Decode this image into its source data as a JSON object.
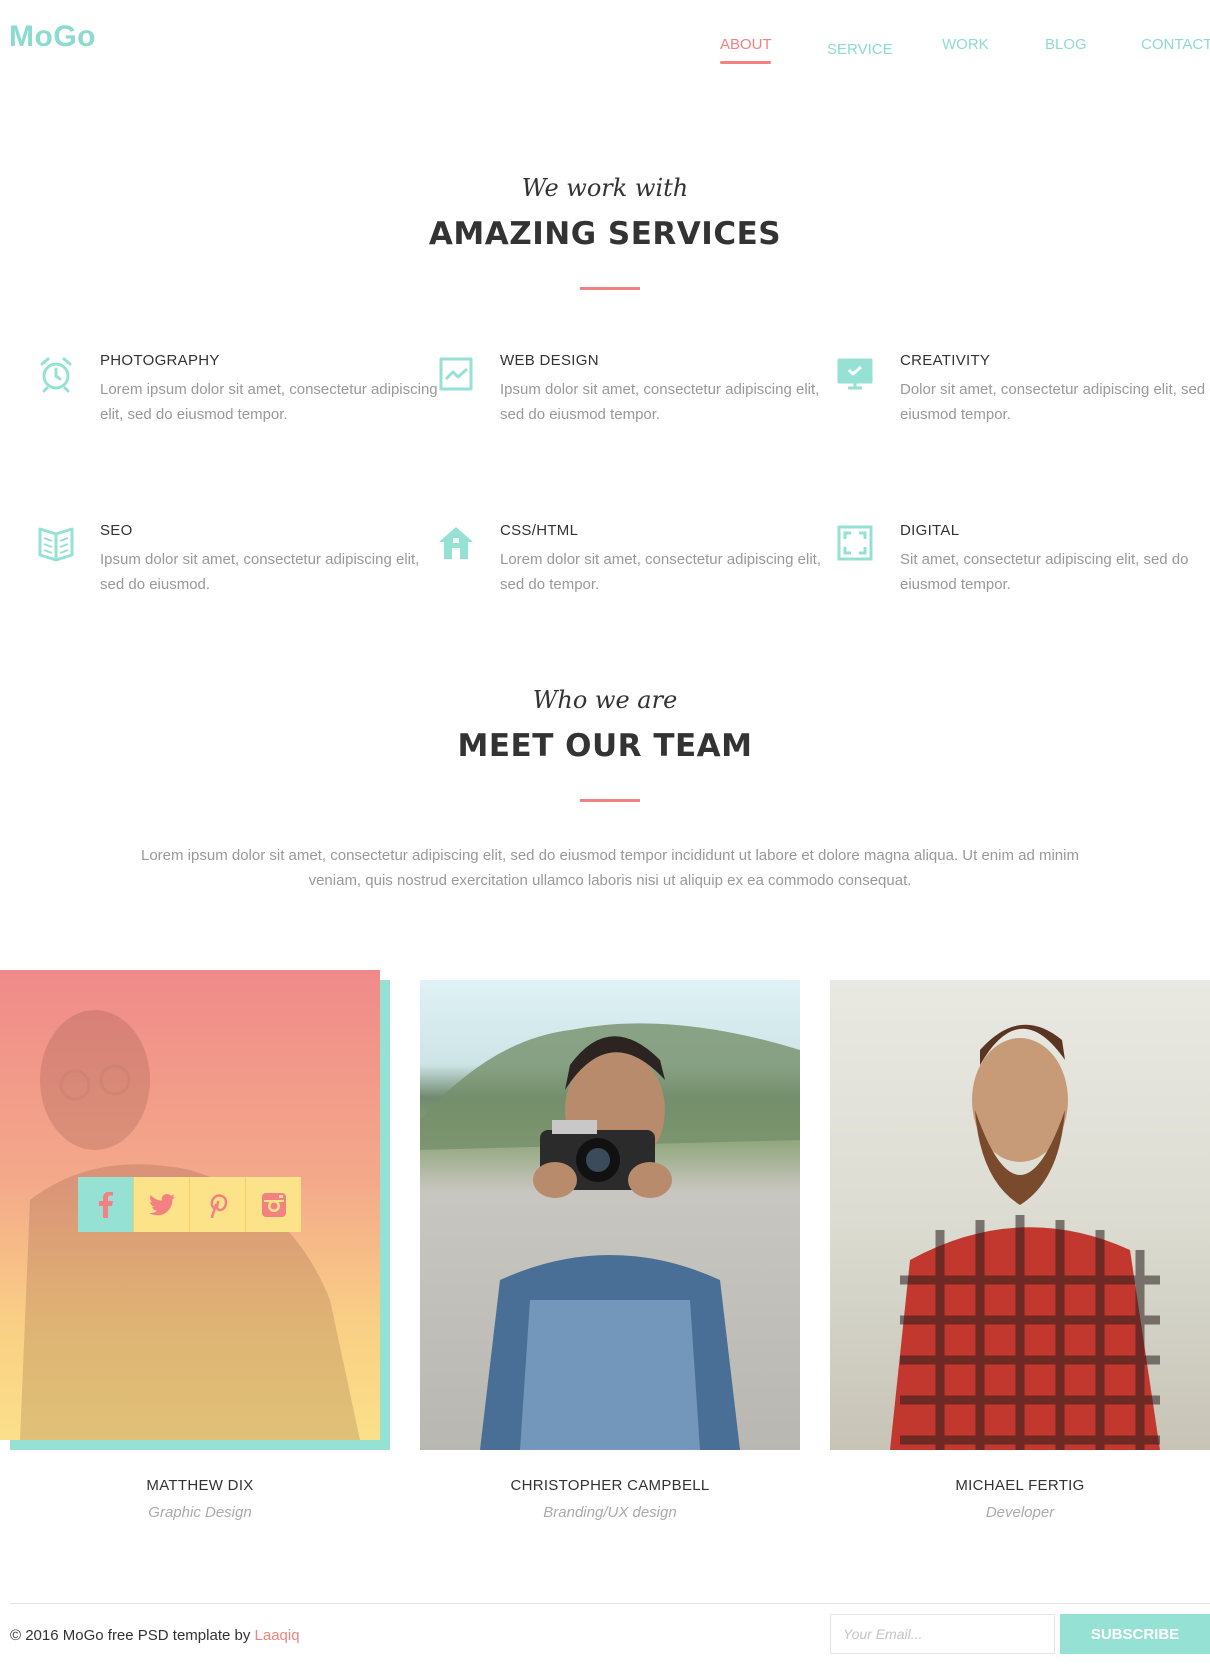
{
  "brand": "MoGo",
  "colors": {
    "teal": "#95e1d3",
    "coral": "#f38181",
    "yellow": "#fce38a",
    "heading": "#333333",
    "muted": "#999999"
  },
  "nav": {
    "items": [
      {
        "label": "ABOUT",
        "active": true
      },
      {
        "label": "SERVICE",
        "active": false
      },
      {
        "label": "WORK",
        "active": false
      },
      {
        "label": "BLOG",
        "active": false
      },
      {
        "label": "CONTACT",
        "active": false
      }
    ]
  },
  "services_section": {
    "script_title": "We work with",
    "title": "AMAZING SERVICES",
    "items": [
      {
        "icon": "alarm-clock-icon",
        "title": "PHOTOGRAPHY",
        "text": "Lorem ipsum dolor sit amet, consectetur adipiscing elit, sed do eiusmod tempor."
      },
      {
        "icon": "chart-icon",
        "title": "WEB DESIGN",
        "text": "Ipsum dolor sit amet, consectetur adipiscing elit, sed do eiusmod tempor."
      },
      {
        "icon": "monitor-icon",
        "title": "CREATIVITY",
        "text": "Dolor sit amet, consectetur adipiscing elit, sed do eiusmod tempor."
      },
      {
        "icon": "book-icon",
        "title": "SEO",
        "text": "Ipsum dolor sit amet, consectetur adipiscing elit, sed do eiusmod."
      },
      {
        "icon": "house-icon",
        "title": "CSS/HTML",
        "text": "Lorem dolor sit amet, consectetur adipiscing elit, sed do tempor."
      },
      {
        "icon": "fullscreen-icon",
        "title": "DIGITAL",
        "text": "Sit amet, consectetur adipiscing elit, sed do eiusmod tempor."
      }
    ]
  },
  "team_section": {
    "script_title": "Who we are",
    "title": "MEET OUR TEAM",
    "text": "Lorem ipsum dolor sit amet, consectetur adipiscing elit, sed do eiusmod tempor incididunt ut labore et dolore magna aliqua. Ut enim ad minim veniam, quis nostrud exercitation ullamco laboris nisi ut aliquip ex ea commodo consequat.",
    "members": [
      {
        "name": "MATTHEW DIX",
        "role": "Graphic Design"
      },
      {
        "name": "CHRISTOPHER CAMPBELL",
        "role": "Branding/UX design"
      },
      {
        "name": "MICHAEL FERTIG",
        "role": "Developer"
      }
    ],
    "social_icons": [
      "facebook-icon",
      "twitter-icon",
      "pinterest-icon",
      "instagram-icon"
    ]
  },
  "footer": {
    "copyright_prefix": "© 2016 MoGo free PSD template by",
    "author_link": "Laaqiq",
    "email_placeholder": "Your Email...",
    "subscribe_label": "SUBSCRIBE"
  }
}
